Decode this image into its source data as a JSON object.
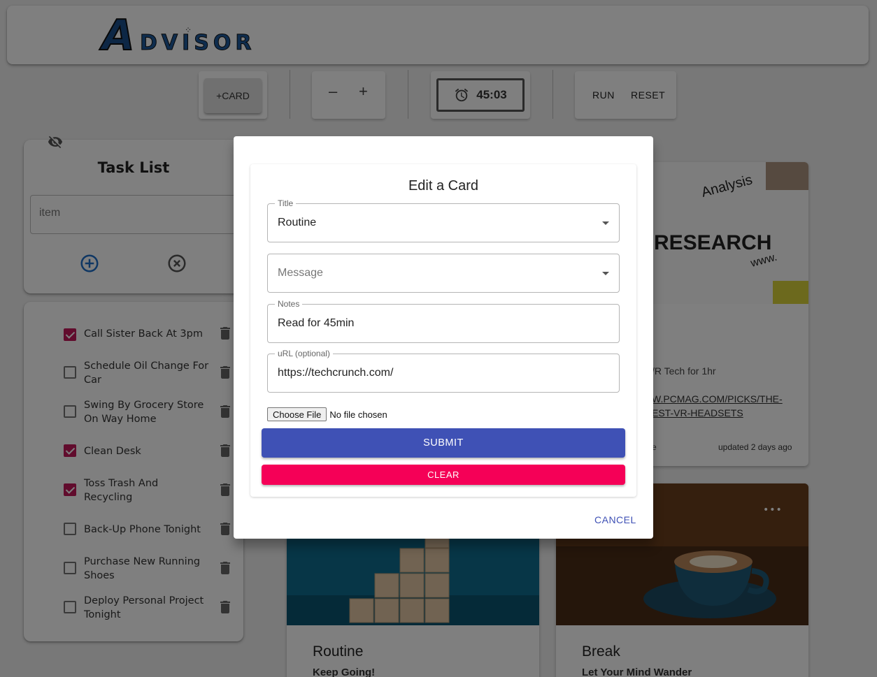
{
  "header": {
    "logo_initial": "A",
    "logo_rest": "DVISOR"
  },
  "toolbar": {
    "add_card_label": "+CARD",
    "zoom_out_label": "–",
    "zoom_in_label": "+",
    "timer_value": "45:03",
    "run_label": "RUN",
    "reset_label": "RESET"
  },
  "task_list": {
    "title": "Task List",
    "input_placeholder": "item",
    "items": [
      {
        "label": "Call Sister Back At 3pm",
        "checked": true
      },
      {
        "label": "Schedule Oil Change For Car",
        "checked": false
      },
      {
        "label": "Swing By Grocery Store On Way Home",
        "checked": false
      },
      {
        "label": "Clean Desk",
        "checked": true
      },
      {
        "label": "Toss Trash And Recycling",
        "checked": true
      },
      {
        "label": "Back-Up Phone Tonight",
        "checked": false
      },
      {
        "label": "Purchase New Running Shoes",
        "checked": false
      },
      {
        "label": "Deploy Personal Project Tonight",
        "checked": false
      }
    ]
  },
  "cards": {
    "research": {
      "notes_fragment": "/R Tech for 1hr",
      "link_line1": "W.PCMAG.COM/PICKS/THE-",
      "link_line2": "EST-VR-HEADSETS",
      "updated": "updated 2 days ago",
      "edge_char": "e"
    },
    "routine": {
      "title": "Routine",
      "subtitle": "Keep Going!"
    },
    "break": {
      "title": "Break",
      "subtitle": "Let Your Mind Wander",
      "menu": "•••"
    }
  },
  "dialog": {
    "heading": "Edit a Card",
    "title_field": {
      "legend": "Title",
      "value": "Routine"
    },
    "message_field": {
      "placeholder": "Message"
    },
    "notes_field": {
      "legend": "Notes",
      "value": "Read for 45min"
    },
    "url_field": {
      "legend": "uRL (optional)",
      "value": "https://techcrunch.com/"
    },
    "choose_file_label": "Choose File",
    "file_status": "No file chosen",
    "submit_label": "SUBMIT",
    "clear_label": "CLEAR",
    "cancel_label": "CANCEL"
  },
  "colors": {
    "primary": "#3f51b5",
    "secondary": "#f50057",
    "checkbox_checked": "#c2185b",
    "icon_blue": "#1e6fc9"
  },
  "icons": [
    "visibility-off-icon",
    "add-circle-icon",
    "cancel-circle-icon",
    "alarm-icon",
    "trash-icon",
    "more-horizontal-icon",
    "dropdown-caret-icon"
  ]
}
